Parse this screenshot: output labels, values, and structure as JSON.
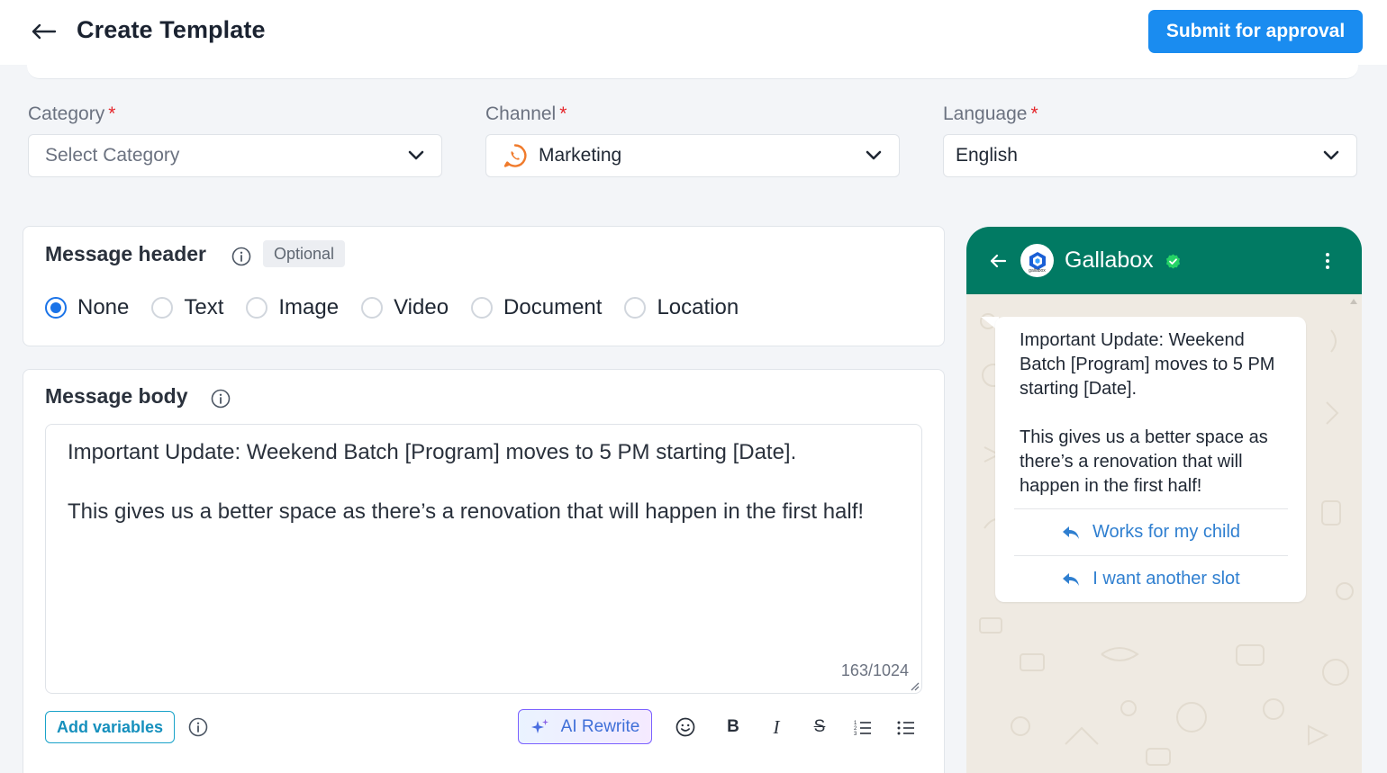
{
  "header": {
    "title": "Create Template",
    "submit_label": "Submit for approval"
  },
  "fields": {
    "category": {
      "label": "Category",
      "required_mark": "*",
      "placeholder": "Select Category"
    },
    "channel": {
      "label": "Channel",
      "required_mark": "*",
      "value": "Marketing",
      "icon": "whatsapp-icon"
    },
    "language": {
      "label": "Language",
      "required_mark": "*",
      "value": "English"
    }
  },
  "message_header": {
    "title": "Message header",
    "badge": "Optional",
    "options": [
      "None",
      "Text",
      "Image",
      "Video",
      "Document",
      "Location"
    ],
    "selected": "None"
  },
  "message_body": {
    "title": "Message body",
    "text": "Important Update: Weekend Batch [Program] moves to 5 PM starting [Date].\n\nThis gives us a better space as there’s a renovation that will happen in the first half!",
    "char_count": "163/1024",
    "add_variables_label": "Add variables",
    "ai_rewrite_label": "AI Rewrite",
    "toolbar": {
      "bold": "B",
      "italic": "I",
      "strike": "S"
    }
  },
  "preview": {
    "brand_name": "Gallabox",
    "avatar_text": "gallabox",
    "bubble_text": "Important Update: Weekend Batch [Program] moves to 5 PM starting [Date].\n\nThis gives us a better space as there’s a renovation that will happen in the first half!",
    "quick_replies": [
      "Works for my child",
      "I want another slot"
    ]
  },
  "colors": {
    "primary": "#1a8cf0",
    "whatsapp_header": "#017a63",
    "required": "#e5262b",
    "link": "#2f7fd0",
    "radio_selected": "#1a73e8"
  }
}
